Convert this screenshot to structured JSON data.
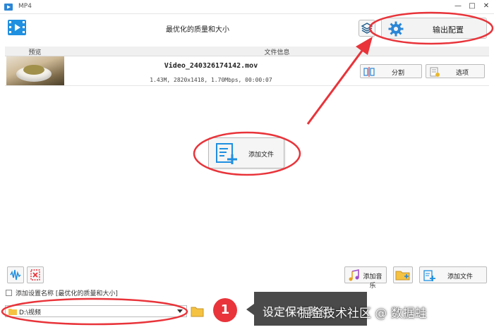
{
  "window": {
    "title": "MP4",
    "minimize": "—",
    "maximize": "□",
    "close": "✕"
  },
  "toolbar": {
    "preset_title": "最优化的质量和大小",
    "output_settings_label": "输出配置"
  },
  "file_list": {
    "headers": {
      "preview": "预览",
      "file_info": "文件信息"
    },
    "rows": [
      {
        "name": "Video_240326174142.mov",
        "meta": "1.43M, 2820x1418, 1.70Mbps, 00:00:07",
        "split_label": "分割",
        "options_label": "选项"
      }
    ]
  },
  "center": {
    "add_file_label": "添加文件"
  },
  "bottom": {
    "add_music_label": "添加音乐",
    "add_file_label": "添加文件",
    "checkbox_label": "添加设置名称 [最优化的质量和大小]",
    "output_path": "D:\\视频"
  },
  "annotation": {
    "badge": "1",
    "tooltip": "设定保存路径"
  },
  "watermark": "掘金技术社区 @ 数据蛙",
  "colors": {
    "accent_blue": "#2b86d6",
    "annotation_red": "#e8343a",
    "tooltip_bg": "#4a4a4a"
  },
  "icons": [
    "app-icon",
    "logo-icon",
    "layers-icon",
    "gear-icon",
    "split-icon",
    "options-icon",
    "add-file-icon",
    "audio-icon",
    "delete-icon",
    "music-icon",
    "add-folder-icon",
    "folder-icon"
  ]
}
